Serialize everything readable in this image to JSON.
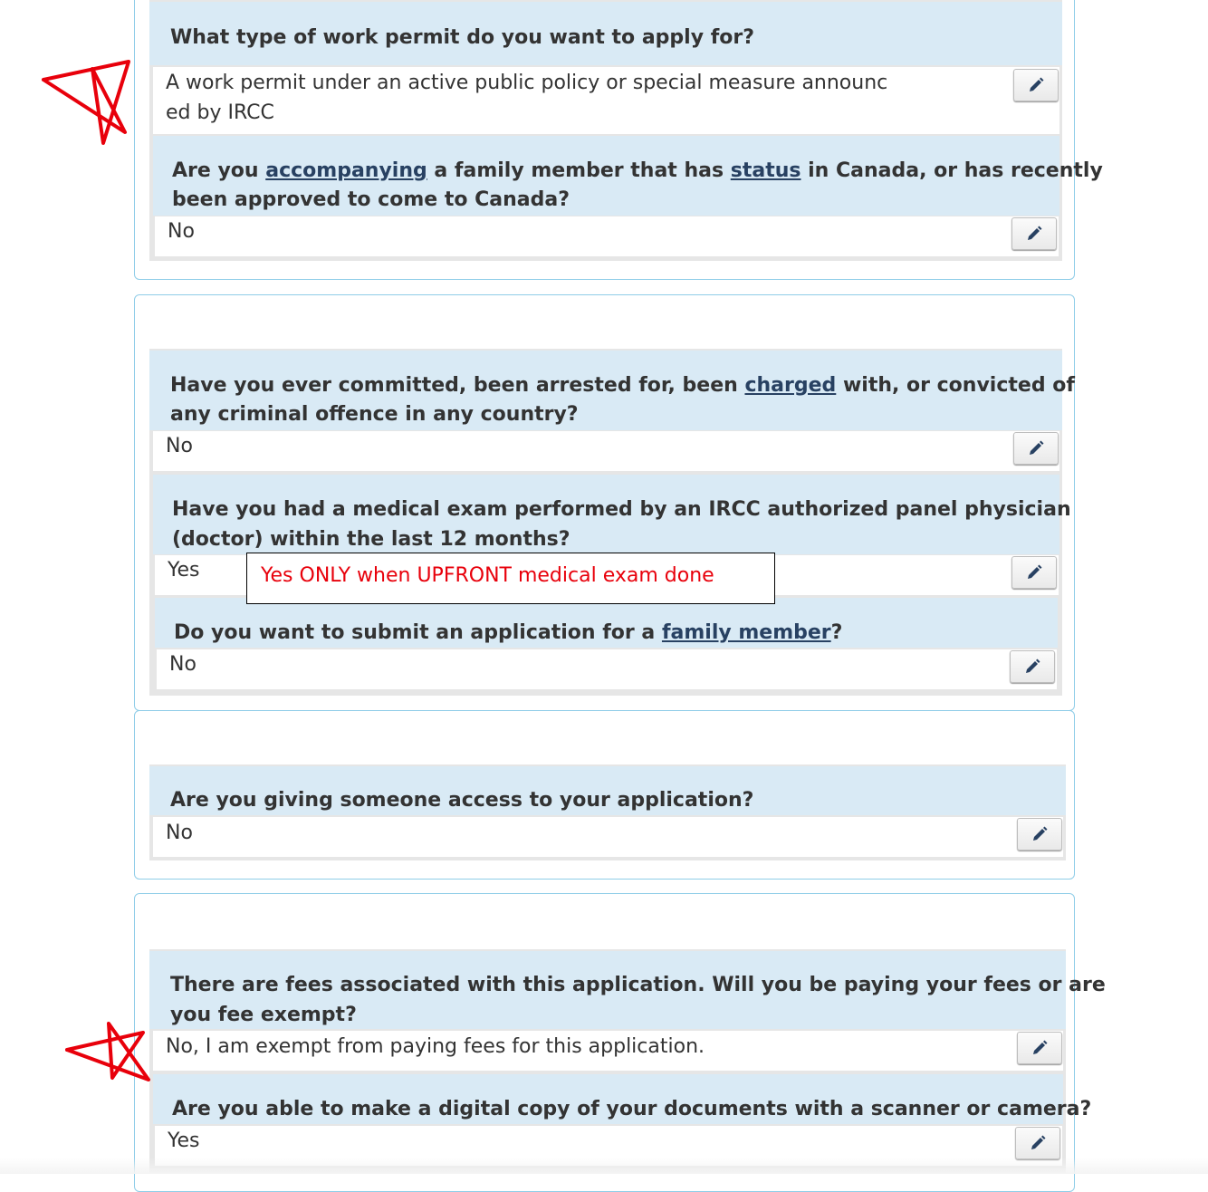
{
  "sections": [
    {
      "questions": [
        {
          "question": [
            "What type of work permit do you want to apply for?"
          ],
          "answer": [
            "A work permit under an active public policy or special measure announc",
            "ed by IRCC"
          ],
          "edit_icon": "pencil-icon"
        },
        {
          "question_parts": [
            "Are you ",
            "accompanying",
            " a family member that has ",
            "status",
            " in Canada, or has recently",
            "been approved to come to Canada?"
          ],
          "answer": [
            "No"
          ],
          "edit_icon": "pencil-icon"
        }
      ]
    },
    {
      "questions": [
        {
          "question_parts": [
            "Have you ever committed, been arrested for, been ",
            "charged",
            " with, or convicted of",
            "any criminal offence in any country?"
          ],
          "answer": [
            "No"
          ],
          "edit_icon": "pencil-icon"
        },
        {
          "question": [
            "Have you had a medical exam performed by an IRCC authorized panel physician",
            "(doctor) within the last 12 months?"
          ],
          "answer": [
            "Yes"
          ],
          "edit_icon": "pencil-icon"
        },
        {
          "question_parts": [
            "Do you want to submit an application for a ",
            "family member",
            "?"
          ],
          "answer": [
            "No"
          ],
          "edit_icon": "pencil-icon"
        }
      ]
    },
    {
      "questions": [
        {
          "question": [
            "Are you giving someone access to your application?"
          ],
          "answer": [
            "No"
          ],
          "edit_icon": "pencil-icon"
        }
      ]
    },
    {
      "questions": [
        {
          "question": [
            "There are fees associated with this application. Will you be paying your fees or are",
            "you fee exempt?"
          ],
          "answer": [
            "No, I am exempt from paying fees for this application."
          ],
          "edit_icon": "pencil-icon"
        },
        {
          "question": [
            "Are you able to make a digital copy of your documents with a scanner or camera?"
          ],
          "answer": [
            "Yes"
          ],
          "edit_icon": "pencil-icon"
        }
      ]
    }
  ],
  "annotation_note": "Yes ONLY when UPFRONT medical exam done",
  "annotation_marks": [
    "star-mark",
    "star-mark"
  ],
  "colors": {
    "question_bg": "#d9eaf5",
    "panel_border": "#8fcde8",
    "link": "#284162",
    "annotation_red": "#e8000b"
  }
}
